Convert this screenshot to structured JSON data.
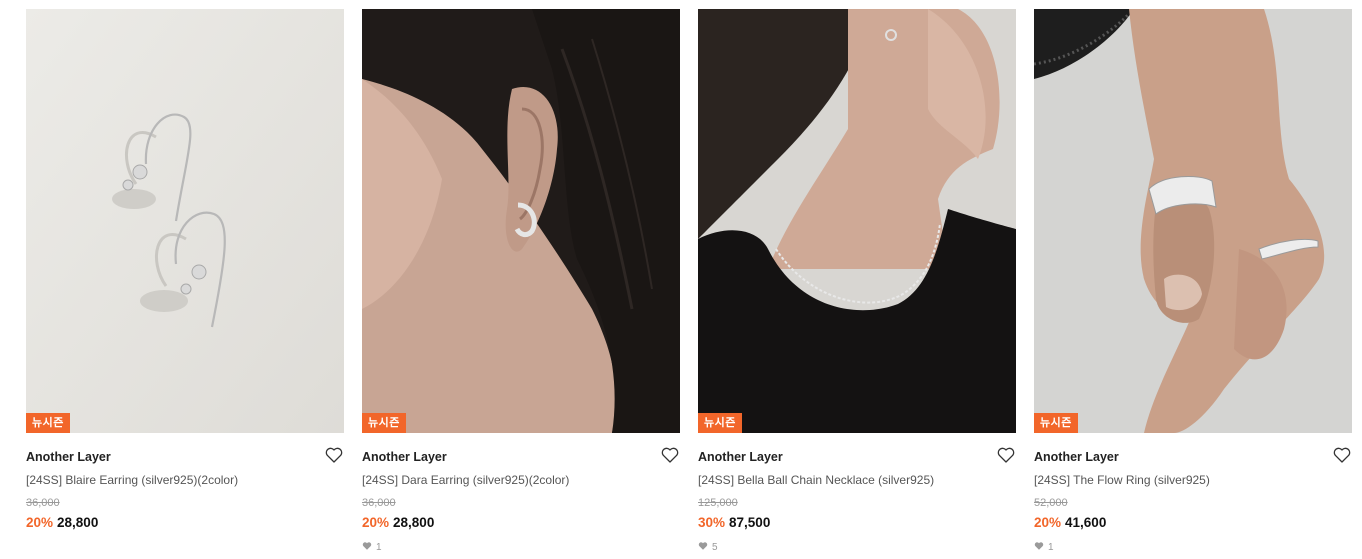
{
  "products": [
    {
      "badge": "뉴시즌",
      "brand": "Another Layer",
      "title": "[24SS] Blaire Earring (silver925)(2color)",
      "original_price": "36,000",
      "discount": "20%",
      "price": "28,800",
      "likes": "",
      "image": "silver hook earrings on white background"
    },
    {
      "badge": "뉴시즌",
      "brand": "Another Layer",
      "title": "[24SS] Dara Earring (silver925)(2color)",
      "original_price": "36,000",
      "discount": "20%",
      "price": "28,800",
      "likes": "1",
      "image": "model wearing silver hoop earring"
    },
    {
      "badge": "뉴시즌",
      "brand": "Another Layer",
      "title": "[24SS] Bella Ball Chain Necklace (silver925)",
      "original_price": "125,000",
      "discount": "30%",
      "price": "87,500",
      "likes": "5",
      "image": "model wearing silver ball chain necklace"
    },
    {
      "badge": "뉴시즌",
      "brand": "Another Layer",
      "title": "[24SS] The Flow Ring (silver925)",
      "original_price": "52,000",
      "discount": "20%",
      "price": "41,600",
      "likes": "1",
      "image": "hand wearing silver rings"
    }
  ],
  "colors": {
    "accent": "#f2662a",
    "text": "#222222",
    "muted": "#999999"
  },
  "icons": {
    "wishlist": "heart-outline-icon",
    "likes": "heart-filled-icon"
  }
}
